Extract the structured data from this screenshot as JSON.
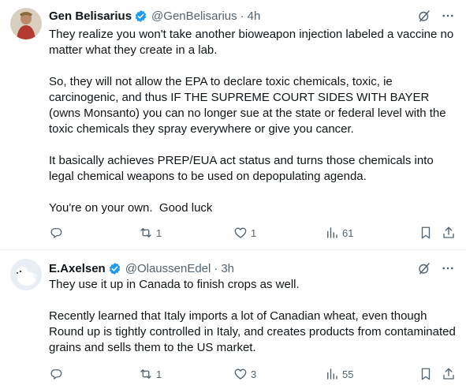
{
  "tweets": [
    {
      "author": {
        "name": "Gen Belisarius",
        "handle": "@GenBelisarius",
        "time": "4h"
      },
      "separator": "·",
      "paragraphs": [
        "They realize you won't take another bioweapon injection labeled a vaccine no matter what they create in a lab.",
        "So, they will not allow the EPA to declare toxic chemicals, toxic, ie carcinogenic, and thus IF THE SUPREME COURT SIDES WITH BAYER (owns Monsanto) you can no longer sue at the state or federal level with the toxic chemicals they spray everywhere or give you cancer.",
        "It basically achieves PREP/EUA act status and turns those chemicals into legal chemical weapons to be used on depopulating agenda.",
        "You're on your own.  Good luck"
      ],
      "stats": {
        "replies": "",
        "reposts": "1",
        "likes": "1",
        "views": "61"
      }
    },
    {
      "author": {
        "name": "E.Axelsen",
        "handle": "@OlaussenEdel",
        "time": "3h"
      },
      "separator": "·",
      "paragraphs": [
        "They use it up in Canada to finish crops as well.",
        "Recently learned that Italy imports a lot of Canadian wheat, even though Round up is tightly controlled in Italy, and creates products from contaminated grains and sells them to the US market."
      ],
      "stats": {
        "replies": "",
        "reposts": "1",
        "likes": "3",
        "views": "55"
      }
    }
  ],
  "colors": {
    "text": "#0f1419",
    "secondary": "#536471",
    "verified": "#1d9bf0",
    "divider": "#eff3f4"
  },
  "icons": [
    "verified-badge-icon",
    "grok-icon",
    "more-icon",
    "reply-icon",
    "retweet-icon",
    "like-icon",
    "views-icon",
    "bookmark-icon",
    "share-icon"
  ]
}
